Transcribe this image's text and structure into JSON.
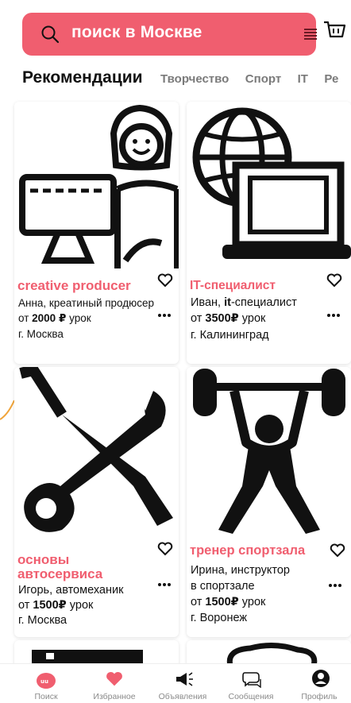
{
  "search": {
    "text": "поиск в Москве"
  },
  "tabs": [
    {
      "label": "Рекомендации",
      "active": true
    },
    {
      "label": "Творчество",
      "active": false
    },
    {
      "label": "Спорт",
      "active": false
    },
    {
      "label": "IT",
      "active": false
    },
    {
      "label": "Ре",
      "active": false
    }
  ],
  "cards": [
    {
      "title": "creative producer",
      "line1": "Анна, креатиный продюсер",
      "price_prefix": "от ",
      "price": "2000 ₽",
      "price_suffix": " урок",
      "city": "г. Москва",
      "image": "woman-at-computer-icon"
    },
    {
      "title": "IT-специалист",
      "line1_a": "Иван, ",
      "line1_b": "it",
      "line1_c": "-специалист",
      "price_prefix": "от ",
      "price": "3500₽",
      "price_suffix": " урок",
      "city": "г. Калининград",
      "image": "globe-laptop-icon"
    },
    {
      "title_1": "основы",
      "title_2": "автосервиса",
      "line1": "Игорь, автомеханик",
      "price_prefix": "от ",
      "price": "1500₽",
      "price_suffix": " урок",
      "city": "г. Москва",
      "image": "wrench-screwdriver-icon"
    },
    {
      "title": "тренер спортзала",
      "line1": "Ирина, инструктор",
      "line2": "в спортзале",
      "price_prefix": "от ",
      "price": "1500₽",
      "price_suffix": " урок",
      "city": "г. Воронеж",
      "image": "weightlifter-icon"
    }
  ],
  "nav": [
    {
      "label": "Поиск",
      "icon": "app-logo-icon",
      "active": true
    },
    {
      "label": "Избранное",
      "icon": "heart-icon"
    },
    {
      "label": "Объявления",
      "icon": "megaphone-icon"
    },
    {
      "label": "Сообщения",
      "icon": "chat-icon"
    },
    {
      "label": "Профиль",
      "icon": "profile-icon"
    }
  ],
  "colors": {
    "accent": "#f05e6f",
    "muted": "#7a7a7a",
    "nav_label": "#8a8a8a"
  }
}
